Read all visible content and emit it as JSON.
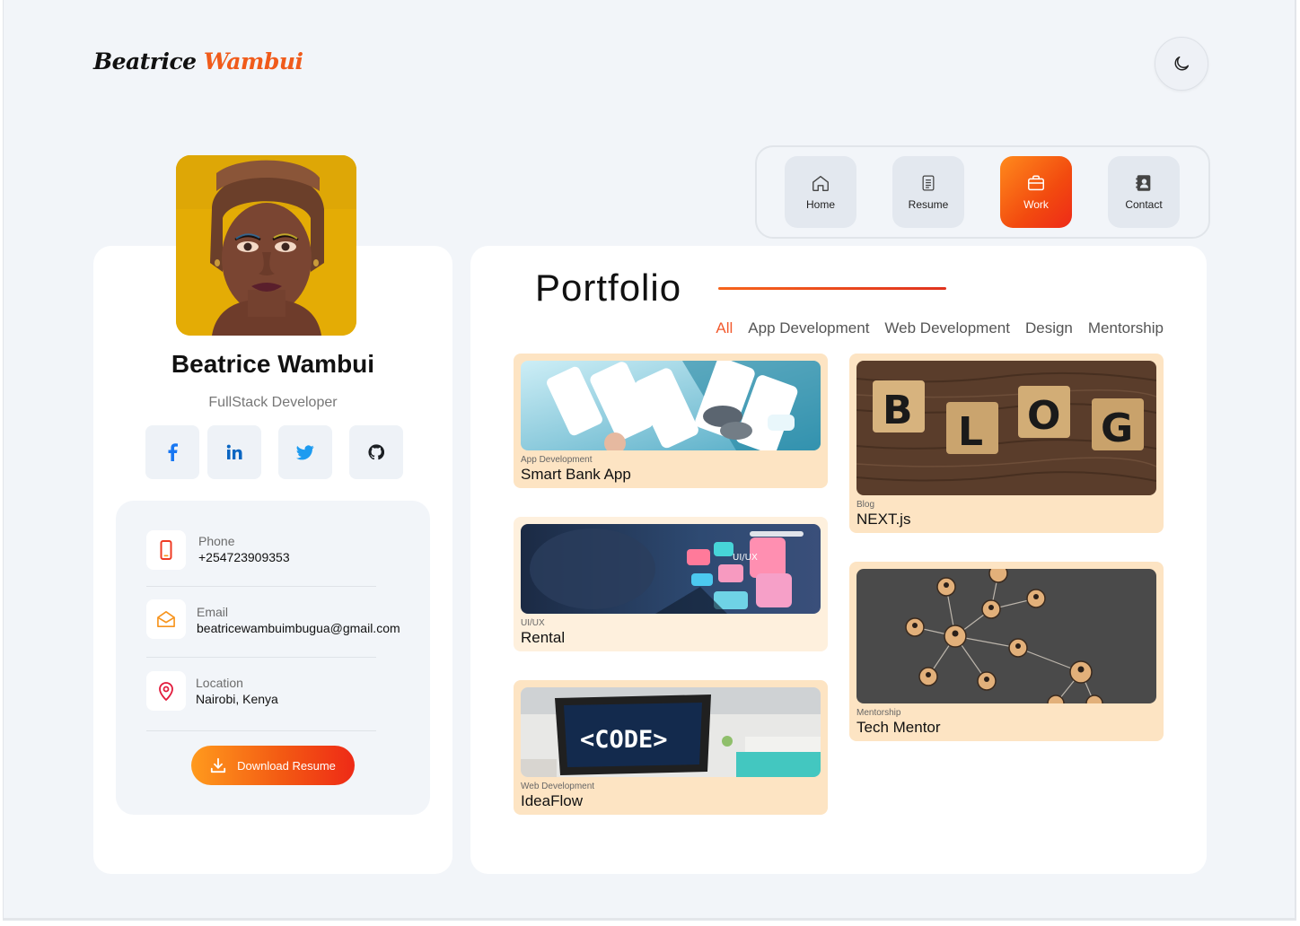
{
  "brand": {
    "first": "Beatrice",
    "last": "Wambui"
  },
  "theme_toggle": {
    "icon": "moon-icon"
  },
  "nav": {
    "items": [
      {
        "label": "Home",
        "icon": "home-icon",
        "active": false
      },
      {
        "label": "Resume",
        "icon": "document-icon",
        "active": false
      },
      {
        "label": "Work",
        "icon": "briefcase-icon",
        "active": true
      },
      {
        "label": "Contact",
        "icon": "contact-book-icon",
        "active": false
      }
    ]
  },
  "profile": {
    "name": "Beatrice Wambui",
    "role": "FullStack Developer",
    "social": [
      "facebook-icon",
      "linkedin-icon",
      "twitter-icon",
      "github-icon"
    ],
    "contact": {
      "phone": {
        "label": "Phone",
        "value": "+254723909353"
      },
      "email": {
        "label": "Email",
        "value": "beatricewambuimbugua@gmail.com"
      },
      "location": {
        "label": "Location",
        "value": "Nairobi, Kenya"
      }
    },
    "download_label": "Download Resume"
  },
  "portfolio": {
    "title": "Portfolio",
    "filters": [
      "All",
      "App Development",
      "Web Development",
      "Design",
      "Mentorship"
    ],
    "active_filter": "All",
    "items": [
      {
        "category": "App Development",
        "title": "Smart Bank App"
      },
      {
        "category": "UI/UX",
        "title": "Rental"
      },
      {
        "category": "Web Development",
        "title": "IdeaFlow",
        "thumb_text": "<CODE>"
      },
      {
        "category": "Blog",
        "title": "NEXT.js",
        "thumb_letters": [
          "B",
          "L",
          "O",
          "G"
        ]
      },
      {
        "category": "Mentorship",
        "title": "Tech Mentor"
      }
    ]
  },
  "colors": {
    "accent": "#f25a1a",
    "card_bg": "#fde4c3",
    "page_bg": "#f2f5f9"
  }
}
